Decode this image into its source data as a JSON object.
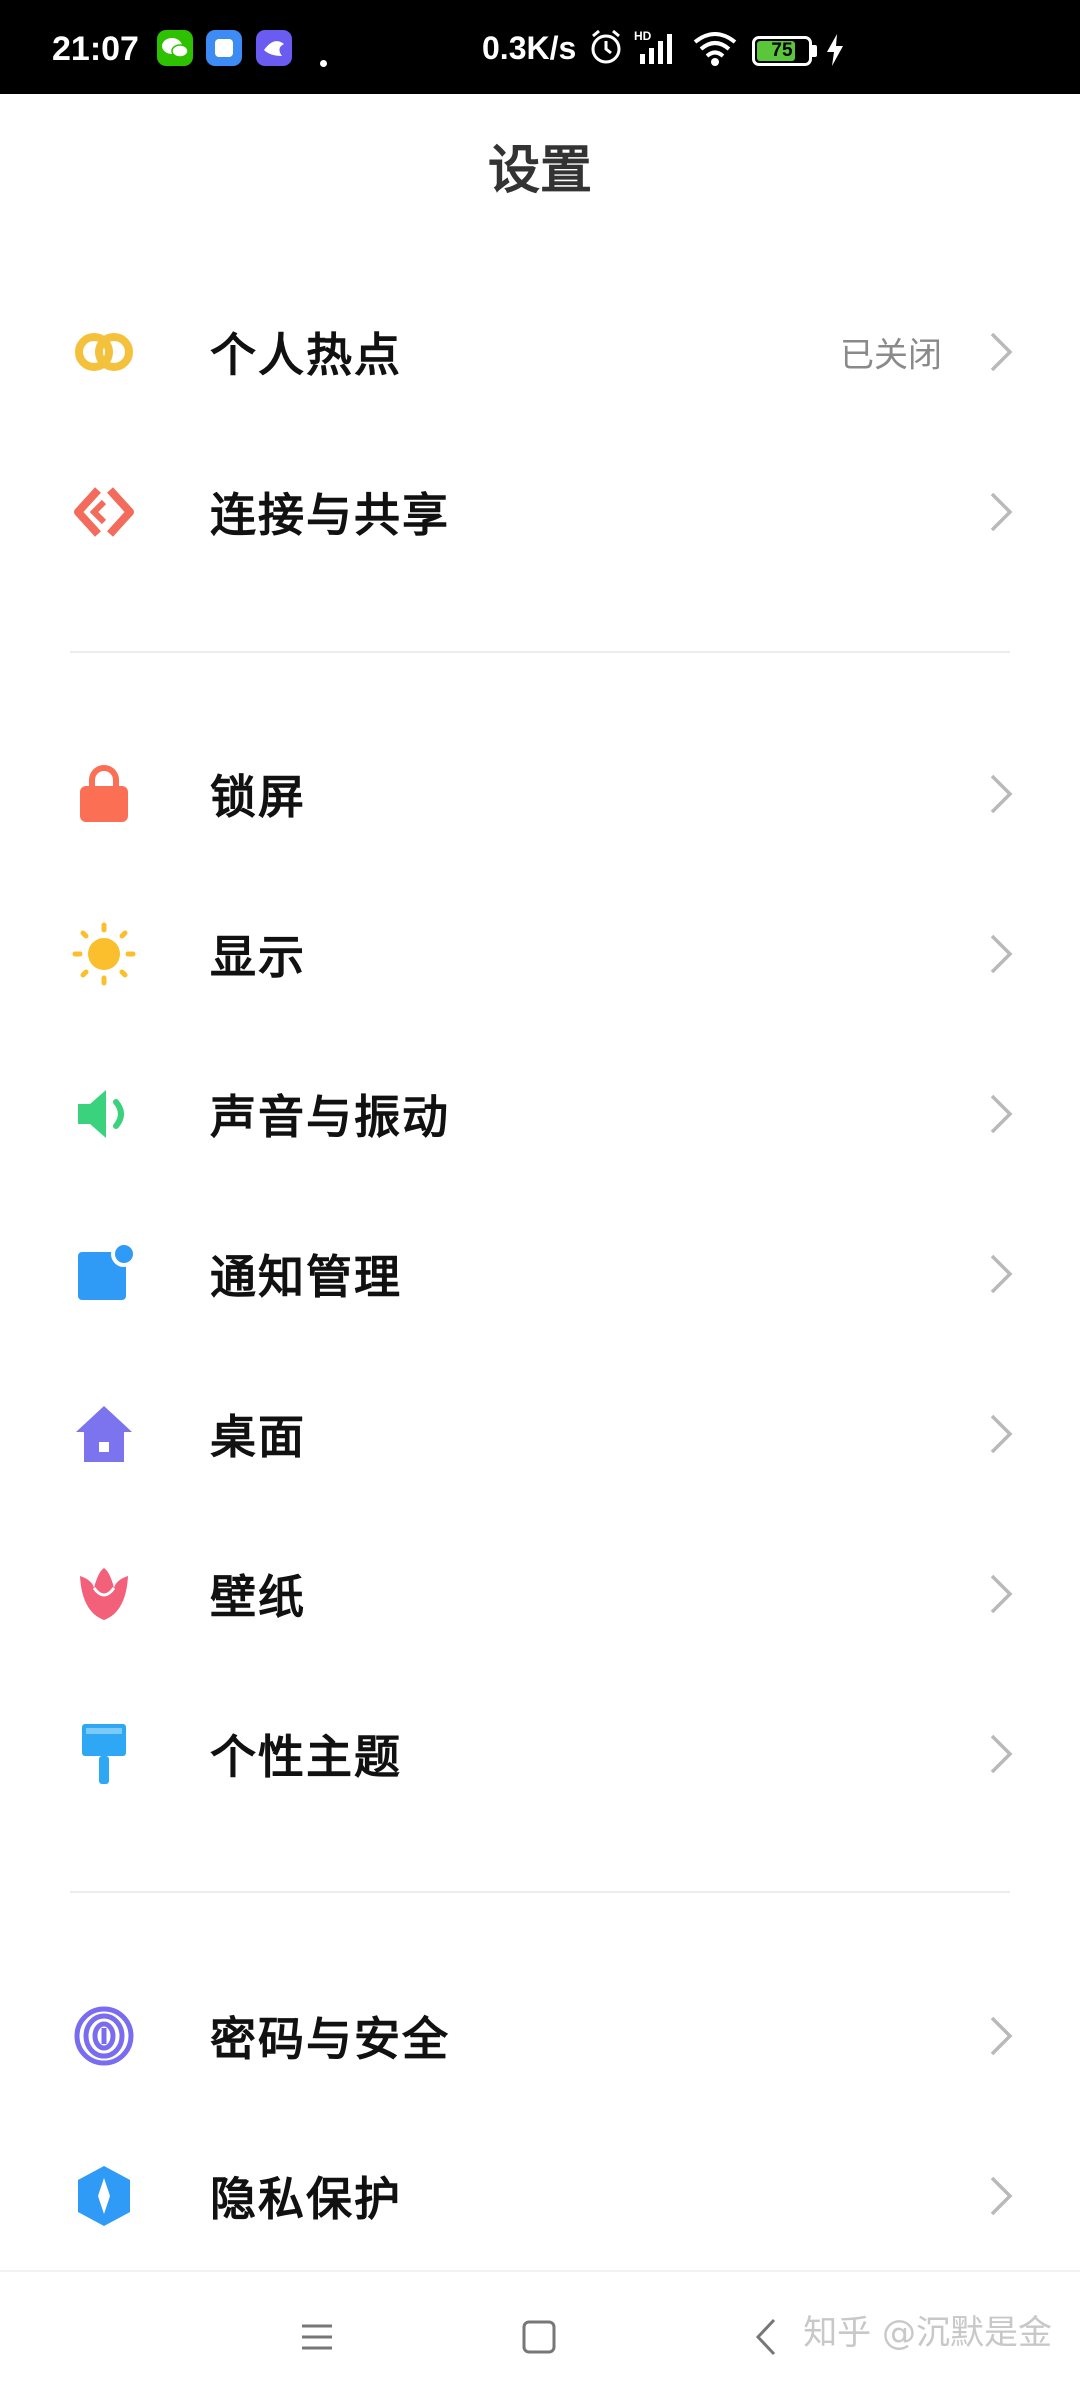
{
  "status_bar": {
    "time": "21:07",
    "net_speed": "0.3K/s",
    "battery_level": "75",
    "battery_fraction": 0.75,
    "signal_tag": "HD",
    "colors": {
      "wechat": "#2dc100",
      "app2": "#3d8cf5",
      "app3": "#6a5cf0",
      "battery": "#5ac63a"
    }
  },
  "page_title": "设置",
  "groups": [
    {
      "items": [
        {
          "label": "个人热点",
          "value": "已关闭",
          "icon": "hotspot-icon",
          "color": "#f4c13c"
        },
        {
          "label": "连接与共享",
          "value": "",
          "icon": "connection-share-icon",
          "color": "#f26b5b"
        }
      ]
    },
    {
      "items": [
        {
          "label": "锁屏",
          "value": "",
          "icon": "lock-icon",
          "color": "#fb6f55"
        },
        {
          "label": "显示",
          "value": "",
          "icon": "sun-icon",
          "color": "#fbbf2e"
        },
        {
          "label": "声音与振动",
          "value": "",
          "icon": "speaker-icon",
          "color": "#3bd27e"
        },
        {
          "label": "通知管理",
          "value": "",
          "icon": "notification-icon",
          "color": "#2f9bf7"
        },
        {
          "label": "桌面",
          "value": "",
          "icon": "home-icon",
          "color": "#7b74ee"
        },
        {
          "label": "壁纸",
          "value": "",
          "icon": "tulip-icon",
          "color": "#f2607a"
        },
        {
          "label": "个性主题",
          "value": "",
          "icon": "paint-brush-icon",
          "color": "#2ea8f5"
        }
      ]
    },
    {
      "items": [
        {
          "label": "密码与安全",
          "value": "",
          "icon": "fingerprint-icon",
          "color": "#7a6cf0"
        },
        {
          "label": "隐私保护",
          "value": "",
          "icon": "privacy-shield-icon",
          "color": "#2f9bf7"
        }
      ]
    }
  ],
  "watermark": "知乎 @沉默是金",
  "nav": {
    "menu_icon": "menu-icon",
    "home_icon": "square-icon",
    "back_icon": "back-icon"
  }
}
